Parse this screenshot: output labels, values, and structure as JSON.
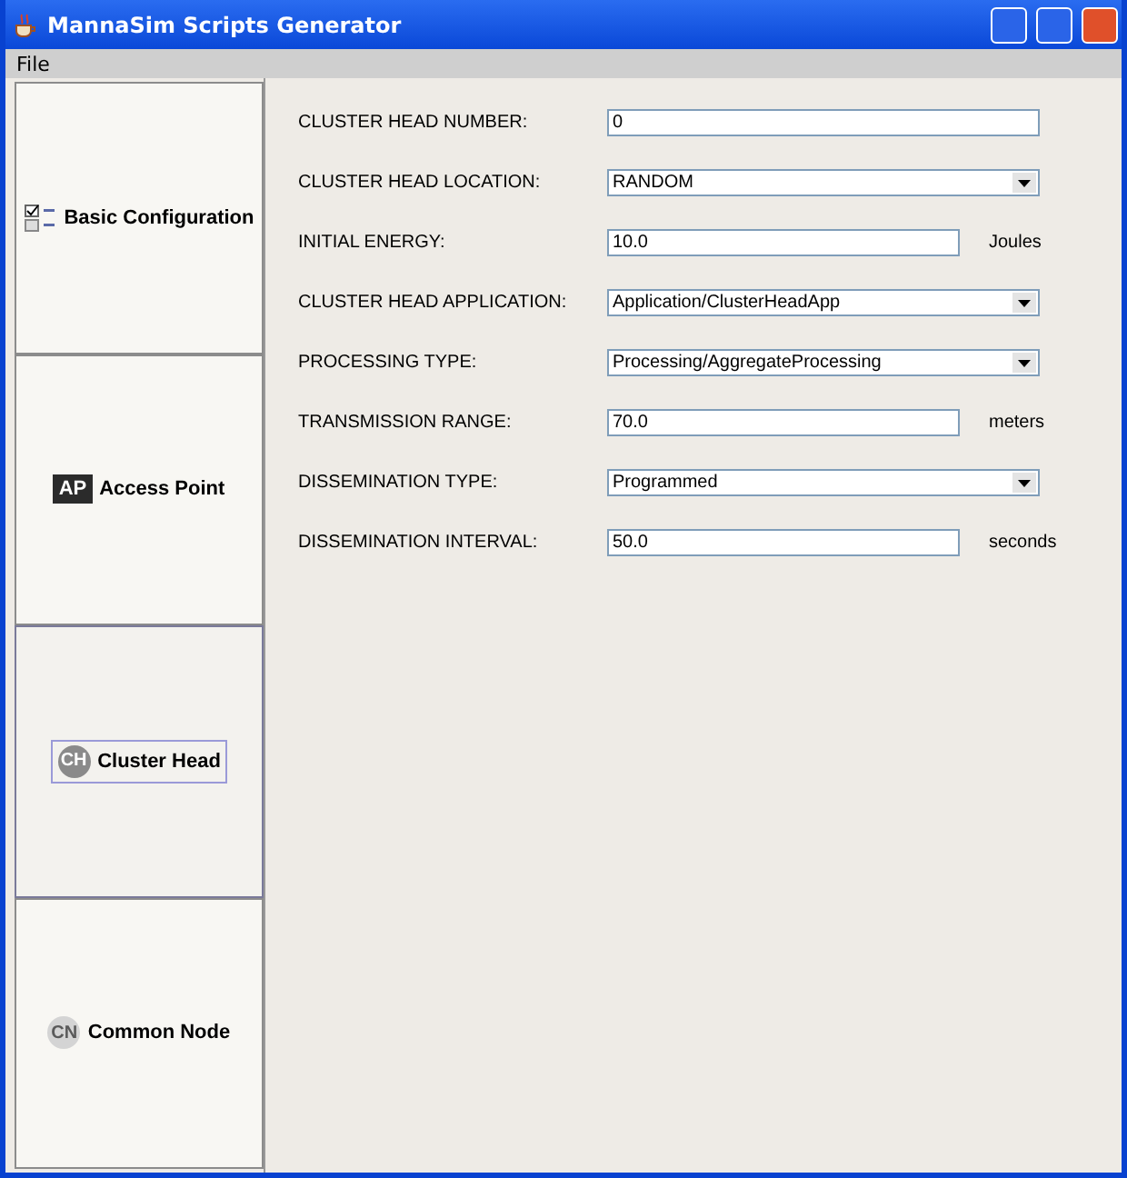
{
  "window": {
    "title": "MannaSim Scripts Generator"
  },
  "menu": [
    "File"
  ],
  "sidebar": {
    "items": [
      {
        "label": "Basic Configuration",
        "kind": "checklist",
        "selected": false
      },
      {
        "label": "Access Point",
        "kind": "square",
        "badge": "AP",
        "color": "#2b2b2b",
        "selected": false
      },
      {
        "label": "Cluster Head",
        "kind": "circle",
        "badge": "CH",
        "color": "#8a8a8a",
        "selected": true
      },
      {
        "label": "Common Node",
        "kind": "circle",
        "badge": "CN",
        "color": "#d4d4d4",
        "selected": false
      }
    ]
  },
  "form": {
    "fields": [
      {
        "label": "CLUSTER HEAD NUMBER:",
        "kind": "text",
        "value": "0"
      },
      {
        "label": "CLUSTER HEAD LOCATION:",
        "kind": "combo",
        "value": "RANDOM"
      },
      {
        "label": "INITIAL ENERGY:",
        "kind": "text",
        "value": "10.0",
        "unit": "Joules"
      },
      {
        "label": "CLUSTER HEAD APPLICATION:",
        "kind": "combo",
        "value": "Application/ClusterHeadApp"
      },
      {
        "label": "PROCESSING TYPE:",
        "kind": "combo",
        "value": "Processing/AggregateProcessing"
      },
      {
        "label": "TRANSMISSION RANGE:",
        "kind": "text",
        "value": "70.0",
        "unit": "meters"
      },
      {
        "label": "DISSEMINATION TYPE:",
        "kind": "combo",
        "value": "Programmed"
      },
      {
        "label": "DISSEMINATION INTERVAL:",
        "kind": "text",
        "value": "50.0",
        "unit": "seconds"
      }
    ]
  }
}
